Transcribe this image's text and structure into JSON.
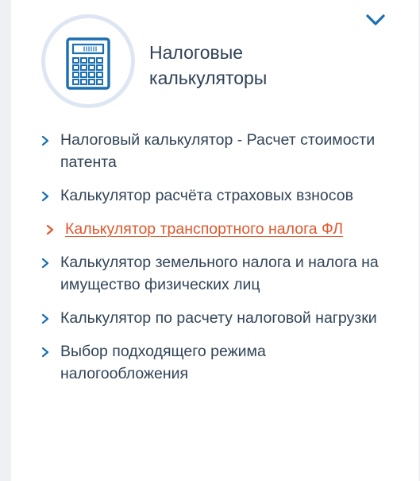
{
  "panel": {
    "title": "Налоговые калькуляторы",
    "icon": "calculator-icon",
    "collapse_icon": "chevron-down-icon"
  },
  "menu": {
    "items": [
      {
        "label": "Налоговый калькулятор - Расчет стоимости патента",
        "active": false
      },
      {
        "label": "Калькулятор расчёта страховых взносов",
        "active": false
      },
      {
        "label": "Калькулятор транспортного налога ФЛ",
        "active": true
      },
      {
        "label": "Калькулятор земельного налога и налога на имущество физических лиц",
        "active": false
      },
      {
        "label": "Калькулятор по расчету налоговой нагрузки",
        "active": false
      },
      {
        "label": "Выбор подходящего режима налогообложения",
        "active": false
      }
    ]
  },
  "colors": {
    "accent": "#1b6fb3",
    "text": "#314457",
    "active_link": "#e0582d",
    "icon_ring": "#dde6f2"
  }
}
